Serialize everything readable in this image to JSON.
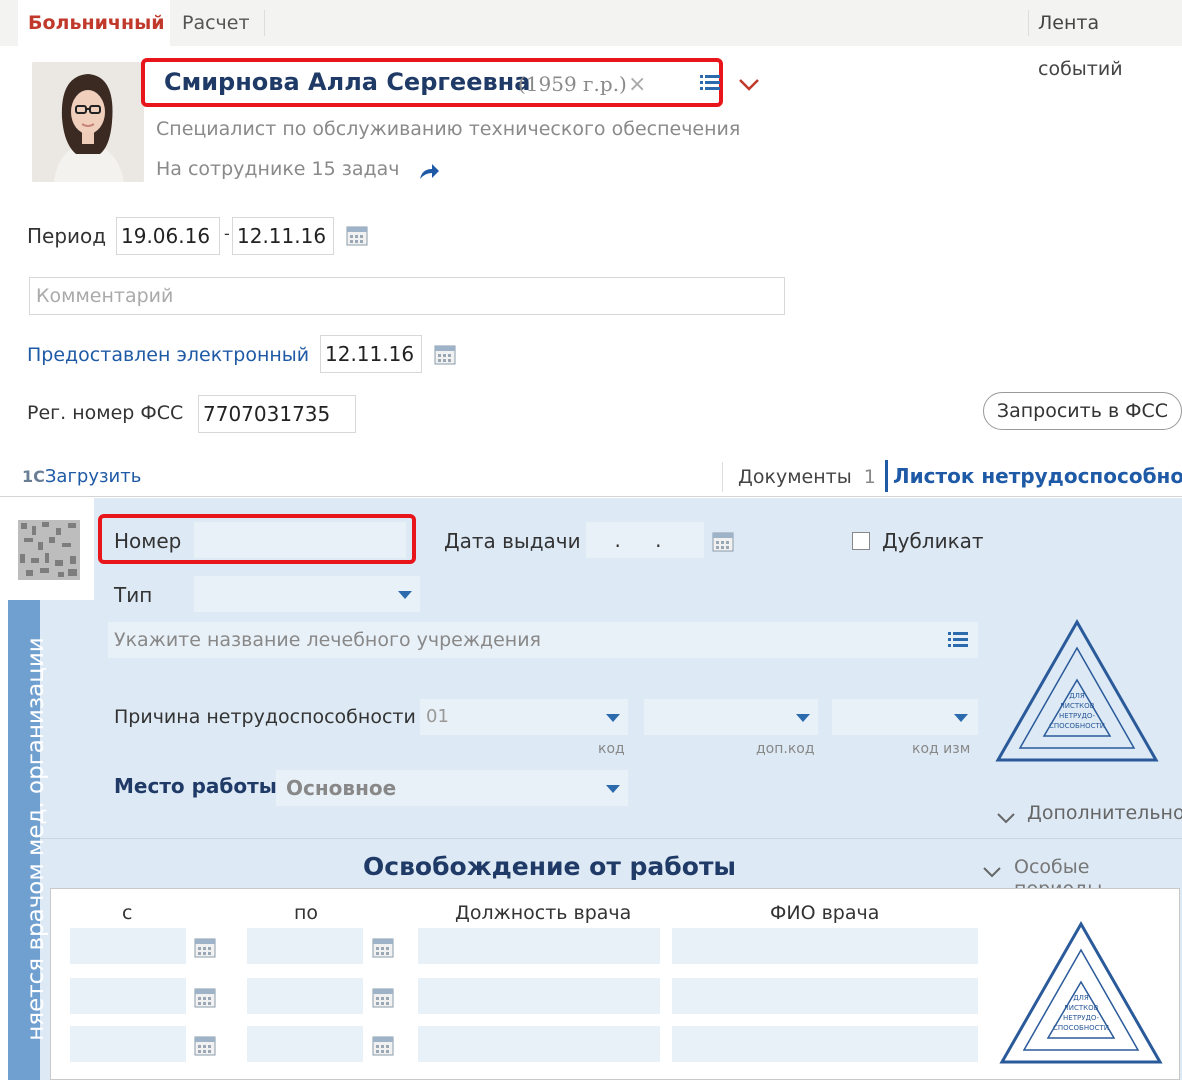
{
  "tabs": {
    "active": "Больничный",
    "second": "Расчет",
    "right": "Лента событий"
  },
  "employee": {
    "name": "Смирнова Алла Сергеевна",
    "birth_year": "(1959 г.р.)",
    "position": "Специалист по обслуживанию технического обеспечения",
    "tasks": "На сотруднике 15 задач"
  },
  "period": {
    "label": "Период",
    "from": "19.06.16",
    "dash": "-",
    "to": "12.11.16"
  },
  "comment": {
    "placeholder": "Комментарий"
  },
  "electronic": {
    "label": "Предоставлен электронный",
    "date": "12.11.16"
  },
  "fss": {
    "label": "Рег. номер ФСС",
    "value": "7707031735",
    "request_button": "Запросить в ФСС"
  },
  "toolbar": {
    "upload": "Загрузить",
    "upload_logo": "1С",
    "documents": "Документы",
    "documents_count": "1",
    "sick_leave_tab": "Листок нетрудоспособности"
  },
  "form": {
    "vertical_label": "няется врачом мед. организации",
    "number_label": "Номер",
    "number_value": "",
    "issue_date_label": "Дата выдачи",
    "issue_date_value": ". .",
    "duplicate_label": "Дубликат",
    "type_label": "Тип",
    "hospital_placeholder": "Укажите название лечебного учреждения",
    "reason_label": "Причина нетрудоспособности",
    "reason_code": "01",
    "code_caption": "код",
    "addcode_caption": "доп.код",
    "changecode_caption": "код изм",
    "workplace_label": "Место работы",
    "workplace_value": "Основное",
    "additional_link": "Дополнительно",
    "stamp_text": "ДЛЯ ЛИСТКОВ НЕТРУДО- СПОСОБНОСТИ"
  },
  "release": {
    "title": "Освобождение от работы",
    "special_periods": "Особые периоды",
    "columns": [
      "с",
      "по",
      "Должность врача",
      "ФИО врача"
    ]
  },
  "colors": {
    "accent_red": "#c0392b",
    "highlight": "#e8161b",
    "panel": "#dde9f4",
    "link_blue": "#1f5aa6"
  }
}
